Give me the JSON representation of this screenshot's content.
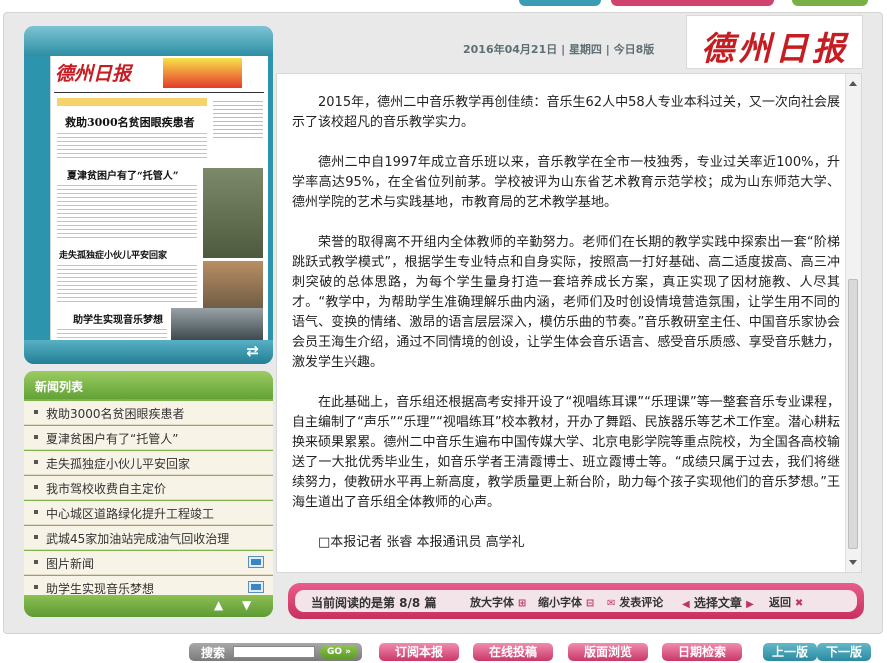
{
  "colors": {
    "accent_teal": "#2c95ad",
    "accent_green": "#7fb44c",
    "accent_pink": "#d3416f",
    "brand_red": "#c61d23"
  },
  "header": {
    "date": "2016年04月21日",
    "weekday": "星期四",
    "pages": "今日8版",
    "brand": "德州日报"
  },
  "paper_thumb": {
    "masthead": "德州日报",
    "headlines": [
      "救助3000名贫困眼疾患者",
      "夏津贫困户有了“托管人”",
      "走失孤独症小伙儿平安回家",
      "助学生实现音乐梦想"
    ],
    "refresh_icon": "refresh-icon"
  },
  "news_list": {
    "title": "新闻列表",
    "items": [
      {
        "label": "救助3000名贫困眼疾患者",
        "has_pic": false
      },
      {
        "label": "夏津贫困户有了“托管人”",
        "has_pic": false
      },
      {
        "label": "走失孤独症小伙儿平安回家",
        "has_pic": false
      },
      {
        "label": "我市驾校收费自主定价",
        "has_pic": false
      },
      {
        "label": "中心城区道路绿化提升工程竣工",
        "has_pic": false
      },
      {
        "label": "武城45家加油站完成油气回收治理",
        "has_pic": false
      },
      {
        "label": "图片新闻",
        "has_pic": true
      },
      {
        "label": "助学生实现音乐梦想",
        "has_pic": true
      }
    ]
  },
  "article": {
    "paragraphs": [
      "2015年，德州二中音乐教学再创佳绩：音乐生62人中58人专业本科过关，又一次向社会展示了该校超凡的音乐教学实力。",
      "德州二中自1997年成立音乐班以来，音乐教学在全市一枝独秀，专业过关率近100%，升学率高达95%，在全省位列前茅。学校被评为山东省艺术教育示范学校；成为山东师范大学、德州学院的艺术与实践基地，市教育局的艺术教学基地。",
      "荣誉的取得离不开组内全体教师的辛勤努力。老师们在长期的教学实践中探索出一套“阶梯跳跃式教学模式”，根据学生专业特点和自身实际，按照高一打好基础、高二适度拔高、高三冲刺突破的总体思路，为每个学生量身打造一套培养成长方案，真正实现了因材施教、人尽其才。“教学中，为帮助学生准确理解乐曲内涵，老师们及时创设情境营造氛围，让学生用不同的语气、变换的情绪、激昂的语言层层深入，模仿乐曲的节奏。”音乐教研室主任、中国音乐家协会会员王海生介绍，通过不同情境的创设，让学生体会音乐语言、感受音乐质感、享受音乐魅力，激发学生兴趣。",
      "在此基础上，音乐组还根据高考安排开设了“视唱练耳课”“乐理课”等一整套音乐专业课程，自主编制了“声乐”“乐理”“视唱练耳”校本教材，开办了舞蹈、民族器乐等艺术工作室。潜心耕耘换来硕果累累。德州二中音乐生遍布中国传媒大学、北京电影学院等重点院校，为全国各高校输送了一大批优秀毕业生，如音乐学者王清霞博士、班立霞博士等。“成绩只属于过去，我们将继续努力，使教研水平再上新高度，教学质量更上新台阶，助力每个孩子实现他们的音乐梦想。”王海生道出了音乐组全体教师的心声。",
      "□本报记者 张睿 本报通讯员 高学礼"
    ]
  },
  "action_bar": {
    "reading": "当前阅读的是第 8/8 篇",
    "zoom_in": "放大字体",
    "zoom_out": "缩小字体",
    "comment": "发表评论",
    "select": "选择文章",
    "back": "返回"
  },
  "bottom_bar": {
    "search_label": "搜索",
    "go": "GO",
    "subscribe": "订阅本报",
    "submit": "在线投稿",
    "browse": "版面浏览",
    "date_search": "日期检索",
    "prev": "上一版",
    "next": "下一版"
  }
}
